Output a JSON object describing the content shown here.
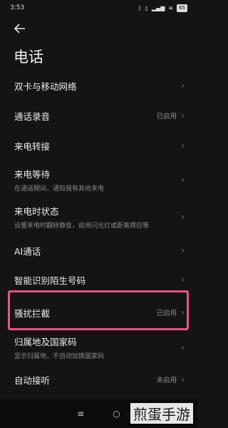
{
  "status_bar": {
    "time": "3:53",
    "icons": [
      "bluetooth-icon",
      "vibrate-icon",
      "signal-icon",
      "wifi-icon"
    ],
    "battery": "65"
  },
  "header": {
    "title": "电话"
  },
  "rows": [
    {
      "label": "双卡与移动网络",
      "sub": "",
      "status": ""
    },
    {
      "label": "通话录音",
      "sub": "",
      "status": "已启用"
    },
    {
      "label": "来电转接",
      "sub": "",
      "status": ""
    },
    {
      "label": "来电等待",
      "sub": "在通话期间，通知我有其他来电",
      "status": ""
    },
    {
      "label": "来电时状态",
      "sub": "设置来电时翻转静音，启用闪光灯或距离感应等",
      "status": ""
    },
    {
      "label": "AI通话",
      "sub": "",
      "status": ""
    },
    {
      "label": "智能识别陌生号码",
      "sub": "",
      "status": ""
    },
    {
      "label": "骚扰拦截",
      "sub": "",
      "status": "已启用"
    },
    {
      "label": "归属地及国家码",
      "sub": "显示归属地，不自动加拨国家码",
      "status": ""
    },
    {
      "label": "自动接听",
      "sub": "",
      "status": "未启用"
    }
  ],
  "nav": {
    "menu": "≡",
    "home": "○"
  },
  "watermark": "煎蛋手游",
  "colors": {
    "highlight": "#e8548a",
    "background": "#141414"
  }
}
